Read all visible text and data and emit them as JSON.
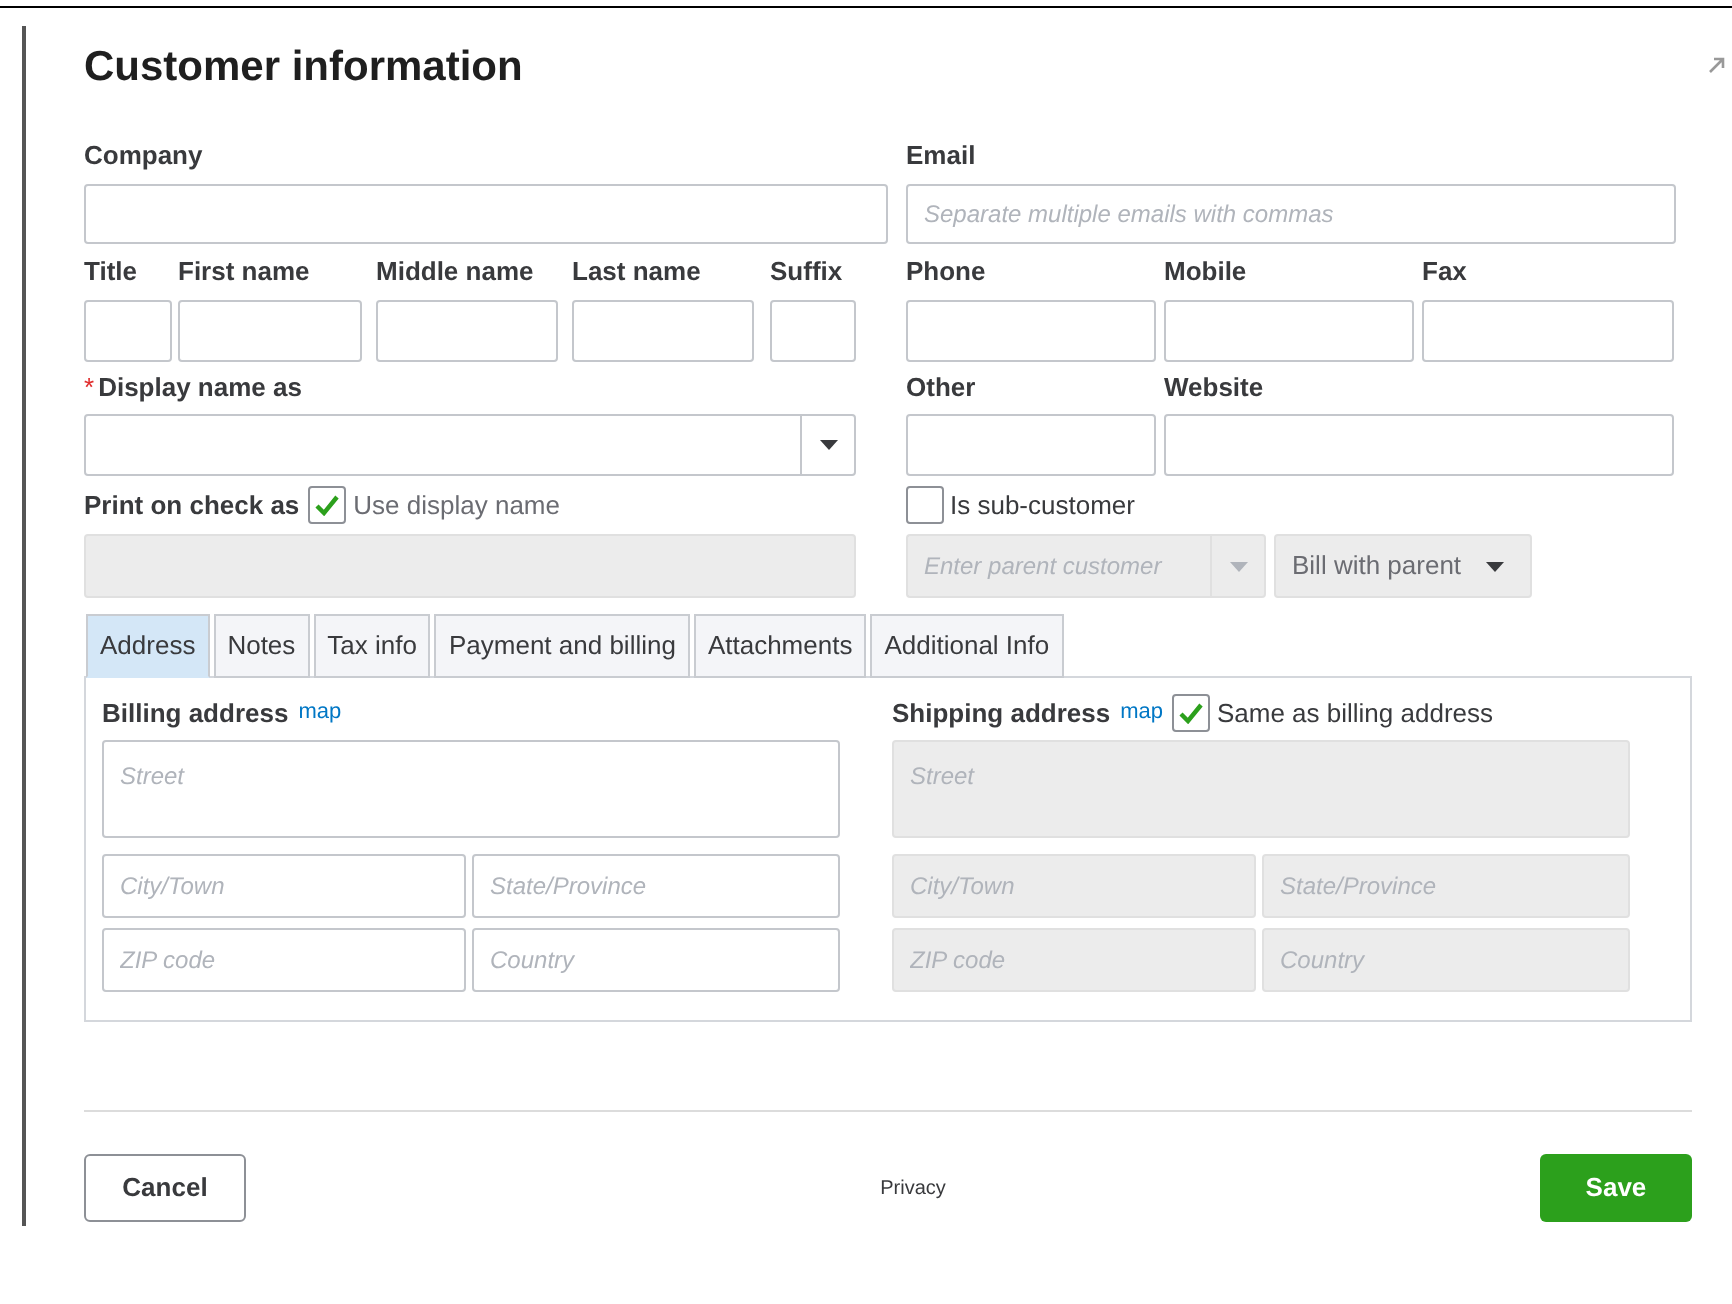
{
  "title": "Customer information",
  "company": {
    "label": "Company"
  },
  "email": {
    "label": "Email",
    "placeholder": "Separate multiple emails with commas"
  },
  "name_fields": [
    {
      "label": "Title"
    },
    {
      "label": "First name"
    },
    {
      "label": "Middle name"
    },
    {
      "label": "Last name"
    },
    {
      "label": "Suffix"
    }
  ],
  "display_name": {
    "label": "Display name as",
    "required": true,
    "required_mark": "*"
  },
  "print_on_check": {
    "label": "Print on check as",
    "checkbox_label": "Use display name",
    "checked": true
  },
  "phone_fields": [
    {
      "label": "Phone"
    },
    {
      "label": "Mobile"
    },
    {
      "label": "Fax"
    }
  ],
  "other_fields": [
    {
      "label": "Other"
    },
    {
      "label": "Website"
    }
  ],
  "sub_customer": {
    "label": "Is sub-customer",
    "checked": false,
    "parent_placeholder": "Enter parent customer",
    "bill_option": "Bill with parent"
  },
  "tabs": [
    {
      "label": "Address",
      "selected": true
    },
    {
      "label": "Notes",
      "selected": false
    },
    {
      "label": "Tax info",
      "selected": false
    },
    {
      "label": "Payment and billing",
      "selected": false
    },
    {
      "label": "Attachments",
      "selected": false
    },
    {
      "label": "Additional Info",
      "selected": false
    }
  ],
  "billing": {
    "title": "Billing address",
    "map_link": "map",
    "street_placeholder": "Street",
    "city_placeholder": "City/Town",
    "state_placeholder": "State/Province",
    "zip_placeholder": "ZIP code",
    "country_placeholder": "Country"
  },
  "shipping": {
    "title": "Shipping address",
    "map_link": "map",
    "same_label": "Same as billing address",
    "same_checked": true,
    "street_placeholder": "Street",
    "city_placeholder": "City/Town",
    "state_placeholder": "State/Province",
    "zip_placeholder": "ZIP code",
    "country_placeholder": "Country"
  },
  "footer": {
    "cancel": "Cancel",
    "privacy": "Privacy",
    "save": "Save"
  }
}
